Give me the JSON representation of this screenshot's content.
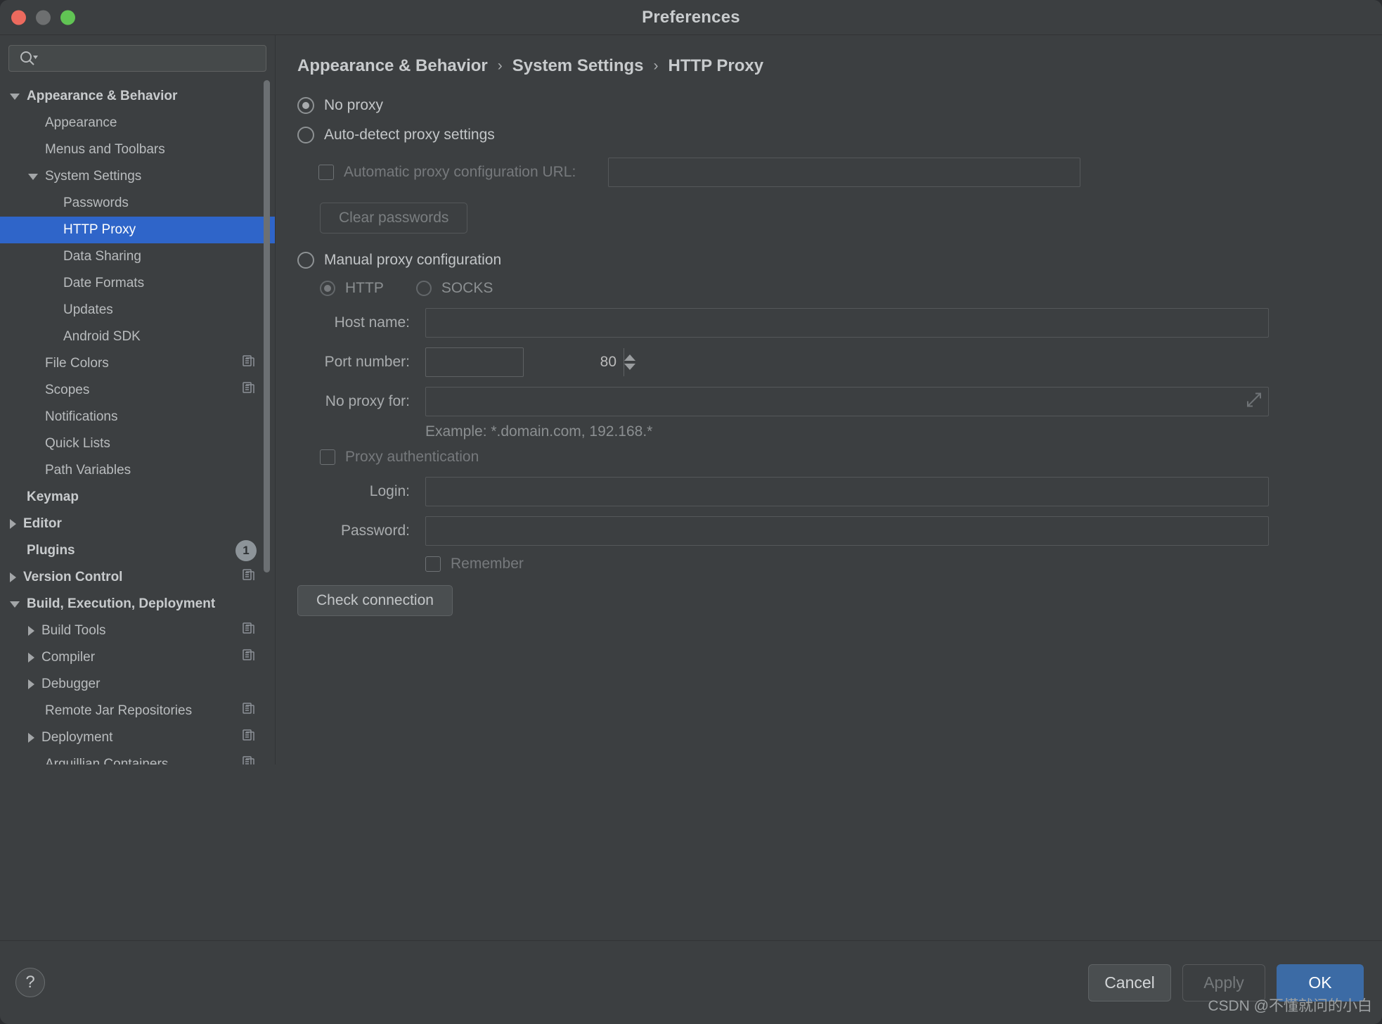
{
  "window": {
    "title": "Preferences",
    "traffic_lights": [
      "close",
      "minimize",
      "zoom"
    ]
  },
  "sidebar": {
    "search": {
      "value": "",
      "placeholder": ""
    },
    "items": [
      {
        "label": "Appearance & Behavior",
        "indent": 0,
        "arrow": "down",
        "bold": true,
        "selected": false,
        "copy": false,
        "badge": null
      },
      {
        "label": "Appearance",
        "indent": 1,
        "arrow": "none",
        "bold": false,
        "selected": false,
        "copy": false,
        "badge": null
      },
      {
        "label": "Menus and Toolbars",
        "indent": 1,
        "arrow": "none",
        "bold": false,
        "selected": false,
        "copy": false,
        "badge": null
      },
      {
        "label": "System Settings",
        "indent": 1,
        "arrow": "down",
        "bold": false,
        "selected": false,
        "copy": false,
        "badge": null
      },
      {
        "label": "Passwords",
        "indent": 2,
        "arrow": "none",
        "bold": false,
        "selected": false,
        "copy": false,
        "badge": null
      },
      {
        "label": "HTTP Proxy",
        "indent": 2,
        "arrow": "none",
        "bold": false,
        "selected": true,
        "copy": false,
        "badge": null
      },
      {
        "label": "Data Sharing",
        "indent": 2,
        "arrow": "none",
        "bold": false,
        "selected": false,
        "copy": false,
        "badge": null
      },
      {
        "label": "Date Formats",
        "indent": 2,
        "arrow": "none",
        "bold": false,
        "selected": false,
        "copy": false,
        "badge": null
      },
      {
        "label": "Updates",
        "indent": 2,
        "arrow": "none",
        "bold": false,
        "selected": false,
        "copy": false,
        "badge": null
      },
      {
        "label": "Android SDK",
        "indent": 2,
        "arrow": "none",
        "bold": false,
        "selected": false,
        "copy": false,
        "badge": null
      },
      {
        "label": "File Colors",
        "indent": 1,
        "arrow": "none",
        "bold": false,
        "selected": false,
        "copy": true,
        "badge": null
      },
      {
        "label": "Scopes",
        "indent": 1,
        "arrow": "none",
        "bold": false,
        "selected": false,
        "copy": true,
        "badge": null
      },
      {
        "label": "Notifications",
        "indent": 1,
        "arrow": "none",
        "bold": false,
        "selected": false,
        "copy": false,
        "badge": null
      },
      {
        "label": "Quick Lists",
        "indent": 1,
        "arrow": "none",
        "bold": false,
        "selected": false,
        "copy": false,
        "badge": null
      },
      {
        "label": "Path Variables",
        "indent": 1,
        "arrow": "none",
        "bold": false,
        "selected": false,
        "copy": false,
        "badge": null
      },
      {
        "label": "Keymap",
        "indent": 0,
        "arrow": "none",
        "bold": true,
        "selected": false,
        "copy": false,
        "badge": null
      },
      {
        "label": "Editor",
        "indent": 0,
        "arrow": "right",
        "bold": true,
        "selected": false,
        "copy": false,
        "badge": null
      },
      {
        "label": "Plugins",
        "indent": 0,
        "arrow": "none",
        "bold": true,
        "selected": false,
        "copy": false,
        "badge": "1"
      },
      {
        "label": "Version Control",
        "indent": 0,
        "arrow": "right",
        "bold": true,
        "selected": false,
        "copy": true,
        "badge": null
      },
      {
        "label": "Build, Execution, Deployment",
        "indent": 0,
        "arrow": "down",
        "bold": true,
        "selected": false,
        "copy": false,
        "badge": null
      },
      {
        "label": "Build Tools",
        "indent": 1,
        "arrow": "right",
        "bold": false,
        "selected": false,
        "copy": true,
        "badge": null
      },
      {
        "label": "Compiler",
        "indent": 1,
        "arrow": "right",
        "bold": false,
        "selected": false,
        "copy": true,
        "badge": null
      },
      {
        "label": "Debugger",
        "indent": 1,
        "arrow": "right",
        "bold": false,
        "selected": false,
        "copy": false,
        "badge": null
      },
      {
        "label": "Remote Jar Repositories",
        "indent": 1,
        "arrow": "none",
        "bold": false,
        "selected": false,
        "copy": true,
        "badge": null
      },
      {
        "label": "Deployment",
        "indent": 1,
        "arrow": "right",
        "bold": false,
        "selected": false,
        "copy": true,
        "badge": null
      },
      {
        "label": "Arquillian Containers",
        "indent": 1,
        "arrow": "none",
        "bold": false,
        "selected": false,
        "copy": true,
        "badge": null
      }
    ]
  },
  "breadcrumb": {
    "part1": "Appearance & Behavior",
    "sep1": "›",
    "part2": "System Settings",
    "sep2": "›",
    "part3": "HTTP Proxy"
  },
  "proxy": {
    "no_proxy_label": "No proxy",
    "no_proxy_selected": true,
    "auto_detect_label": "Auto-detect proxy settings",
    "auto_detect_selected": false,
    "auto_url_checkbox_label": "Automatic proxy configuration URL:",
    "auto_url_checked": false,
    "auto_url_value": "",
    "clear_passwords_label": "Clear passwords",
    "manual_label": "Manual proxy configuration",
    "manual_selected": false,
    "http_label": "HTTP",
    "http_selected": true,
    "socks_label": "SOCKS",
    "socks_selected": false,
    "host_name_label": "Host name:",
    "host_name_value": "",
    "port_number_label": "Port number:",
    "port_number_value": "80",
    "no_proxy_for_label": "No proxy for:",
    "no_proxy_for_value": "",
    "example_hint": "Example: *.domain.com, 192.168.*",
    "proxy_auth_label": "Proxy authentication",
    "proxy_auth_checked": false,
    "login_label": "Login:",
    "login_value": "",
    "password_label": "Password:",
    "password_value": "",
    "remember_label": "Remember",
    "remember_checked": false,
    "check_connection_label": "Check connection"
  },
  "footer": {
    "help_glyph": "?",
    "cancel_label": "Cancel",
    "apply_label": "Apply",
    "ok_label": "OK"
  },
  "watermark": "CSDN @不懂就问的小白",
  "colors": {
    "accent_selection": "#2f65c9",
    "ok_button": "#3c6ba5",
    "window_bg": "#3c3f41",
    "traffic_red": "#ec6a5e",
    "traffic_yellow": "#6d6f70",
    "traffic_green": "#61c454"
  }
}
